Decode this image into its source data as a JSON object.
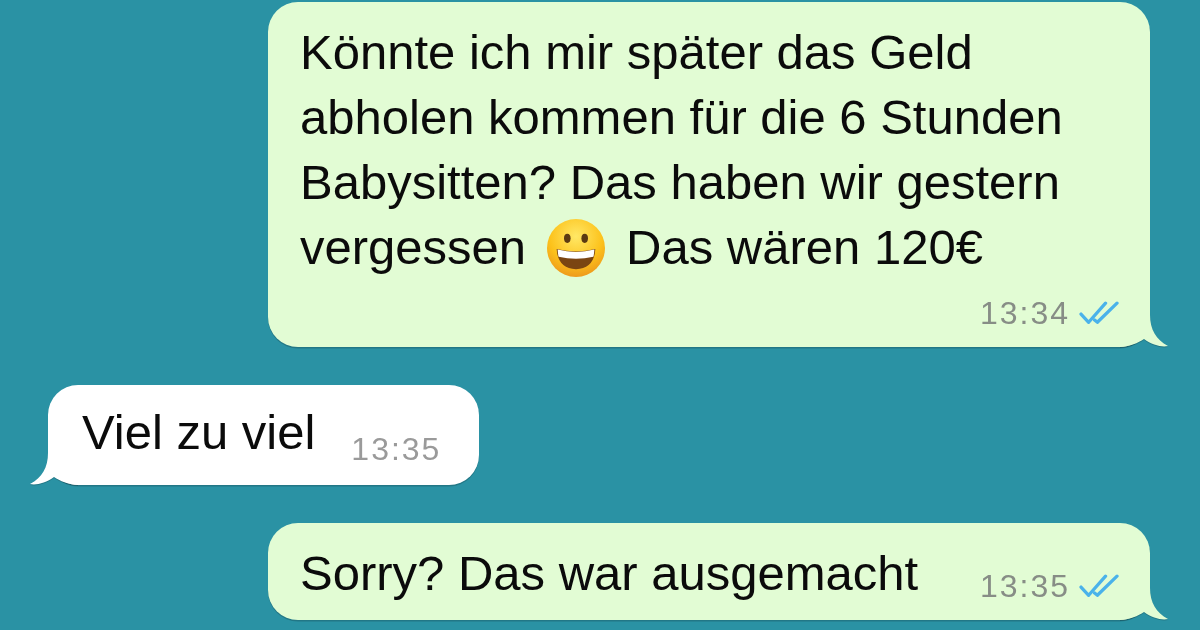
{
  "messages": [
    {
      "kind": "outgoing",
      "parts": [
        {
          "kind": "text",
          "text": "Könnte ich mir später das Geld abholen kommen für die 6 Stunden Babysitten? Das haben wir gestern vergessen"
        },
        {
          "kind": "emoji"
        },
        {
          "kind": "text",
          "text": "Das wären 120€"
        }
      ],
      "time": "13:34",
      "read": true
    },
    {
      "kind": "incoming",
      "parts": [
        {
          "kind": "text",
          "text": "Viel zu viel"
        }
      ],
      "time": "13:35"
    },
    {
      "kind": "outgoing",
      "parts": [
        {
          "kind": "text",
          "text": "Sorry? Das war ausgemacht"
        }
      ],
      "time": "13:35",
      "read": true
    }
  ]
}
